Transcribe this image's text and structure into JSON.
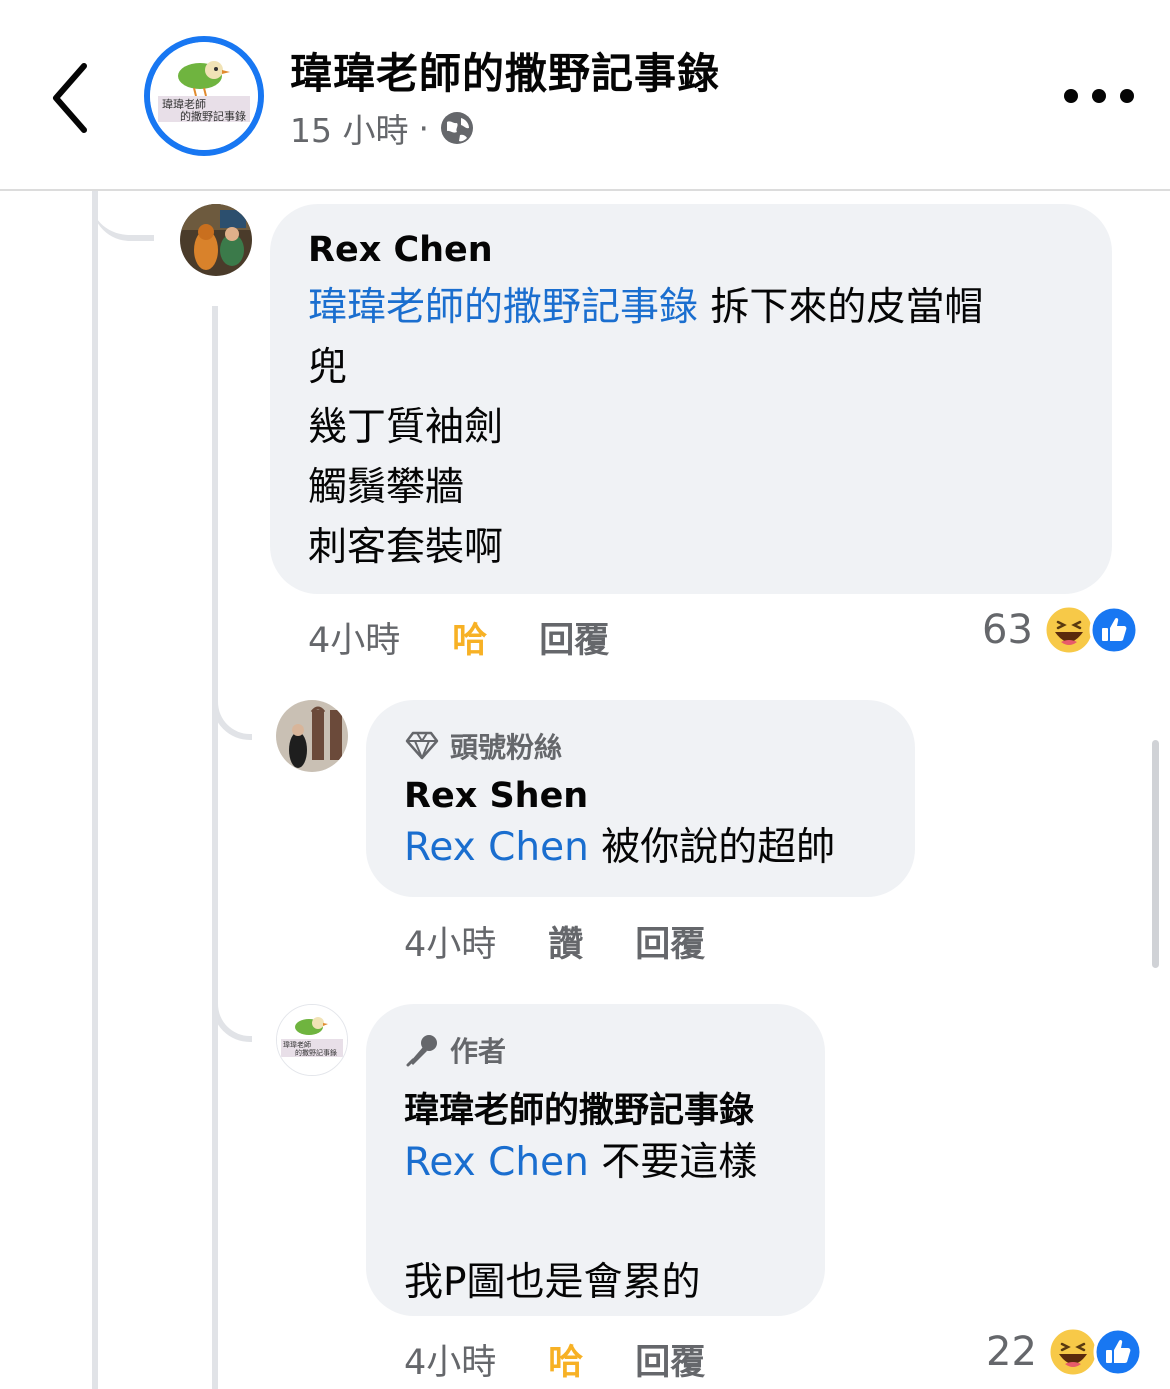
{
  "header": {
    "page_name": "瑋瑋老師的撒野記事錄",
    "post_time": "15 小時",
    "dot": "·",
    "avatar_text_1": "瑋瑋老師",
    "avatar_text_2": "的撒野記事錄"
  },
  "comments": [
    {
      "author": "Rex Chen",
      "mention": "瑋瑋老師的撒野記事錄",
      "text_line_1": " 拆下來的皮當帽",
      "text_lines": [
        "兜",
        "幾丁質袖劍",
        "觸鬚攀牆",
        "刺客套裝啊"
      ],
      "time": "4小時",
      "reaction_label": "哈",
      "reply_label": "回覆",
      "reaction_count": "63"
    },
    {
      "badge": "頭號粉絲",
      "author": "Rex Shen",
      "mention": "Rex Chen",
      "text": " 被你說的超帥",
      "time": "4小時",
      "reaction_label": "讚",
      "reply_label": "回覆"
    },
    {
      "badge": "作者",
      "author": "瑋瑋老師的撒野記事錄",
      "mention": "Rex Chen",
      "text": " 不要這樣",
      "text_2": "我P圖也是會累的",
      "time": "4小時",
      "reaction_label": "哈",
      "reply_label": "回覆",
      "reaction_count": "22",
      "avatar_text_1": "瑋瑋老師",
      "avatar_text_2": "的撒野記事錄"
    }
  ],
  "colors": {
    "accent": "#1877f2",
    "mention": "#1a6ecf",
    "haha": "#f7b125",
    "muted": "#65676b",
    "bubble": "#f0f2f5"
  },
  "icons": [
    "back-chevron-icon",
    "globe-icon",
    "more-icon",
    "diamond-icon",
    "microphone-icon",
    "haha-emoji-icon",
    "like-icon"
  ]
}
